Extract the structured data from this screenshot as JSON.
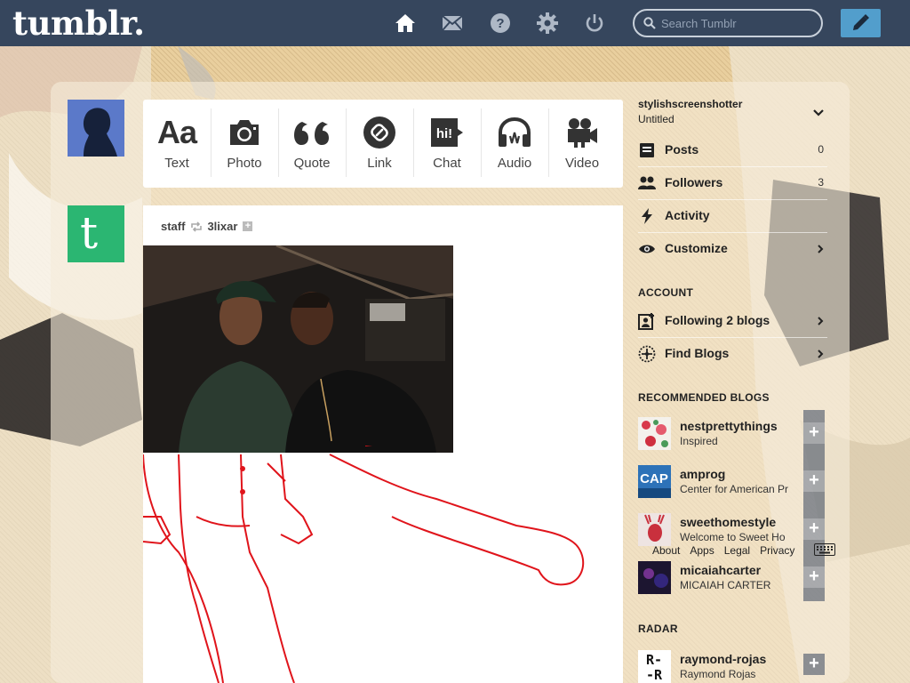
{
  "header": {
    "logo": "tumblr.",
    "nav": [
      "home-icon",
      "mail-icon",
      "help-icon",
      "gear-icon",
      "power-icon"
    ],
    "search_placeholder": "Search Tumblr",
    "compose_icon": "pencil-icon"
  },
  "post_types": [
    {
      "label": "Text",
      "icon": "text-icon",
      "glyph": "Aa"
    },
    {
      "label": "Photo",
      "icon": "camera-icon"
    },
    {
      "label": "Quote",
      "icon": "quote-icon"
    },
    {
      "label": "Link",
      "icon": "link-icon"
    },
    {
      "label": "Chat",
      "icon": "chat-icon",
      "glyph": "hi!"
    },
    {
      "label": "Audio",
      "icon": "headphones-icon"
    },
    {
      "label": "Video",
      "icon": "video-camera-icon"
    }
  ],
  "post": {
    "author": "staff",
    "reblogged_from": "3lixar",
    "follow_icon": "plus-icon"
  },
  "sidebar": {
    "blog_name": "stylishscreenshotter",
    "blog_title": "Untitled",
    "items": [
      {
        "label": "Posts",
        "count": "0",
        "icon": "posts-icon"
      },
      {
        "label": "Followers",
        "count": "3",
        "icon": "followers-icon"
      },
      {
        "label": "Activity",
        "icon": "lightning-icon"
      },
      {
        "label": "Customize",
        "icon": "eye-icon"
      }
    ],
    "account_heading": "ACCOUNT",
    "account_items": [
      {
        "label": "Following 2 blogs",
        "icon": "following-icon"
      },
      {
        "label": "Find Blogs",
        "icon": "compass-icon"
      }
    ],
    "recommended_heading": "RECOMMENDED BLOGS",
    "recommended": [
      {
        "name": "nestprettythings",
        "desc": "Inspired"
      },
      {
        "name": "amprog",
        "desc": "Center for American Pr",
        "avatar_text": "CAP"
      },
      {
        "name": "sweethomestyle",
        "desc": "Welcome to Sweet Ho"
      },
      {
        "name": "micaiahcarter",
        "desc": "MICAIAH CARTER"
      }
    ],
    "radar_heading": "RADAR",
    "radar": [
      {
        "name": "raymond-rojas",
        "desc": "Raymond Rojas",
        "avatar_text": "R-\n-R"
      }
    ],
    "footer_links": [
      "About",
      "Apps",
      "Legal",
      "Privacy"
    ]
  },
  "colors": {
    "header_bg": "#36465d",
    "accent": "#529ecc",
    "staff_green": "#2bb672",
    "drawing_red": "#e0141b",
    "backdrop": "#e9cf9e"
  }
}
